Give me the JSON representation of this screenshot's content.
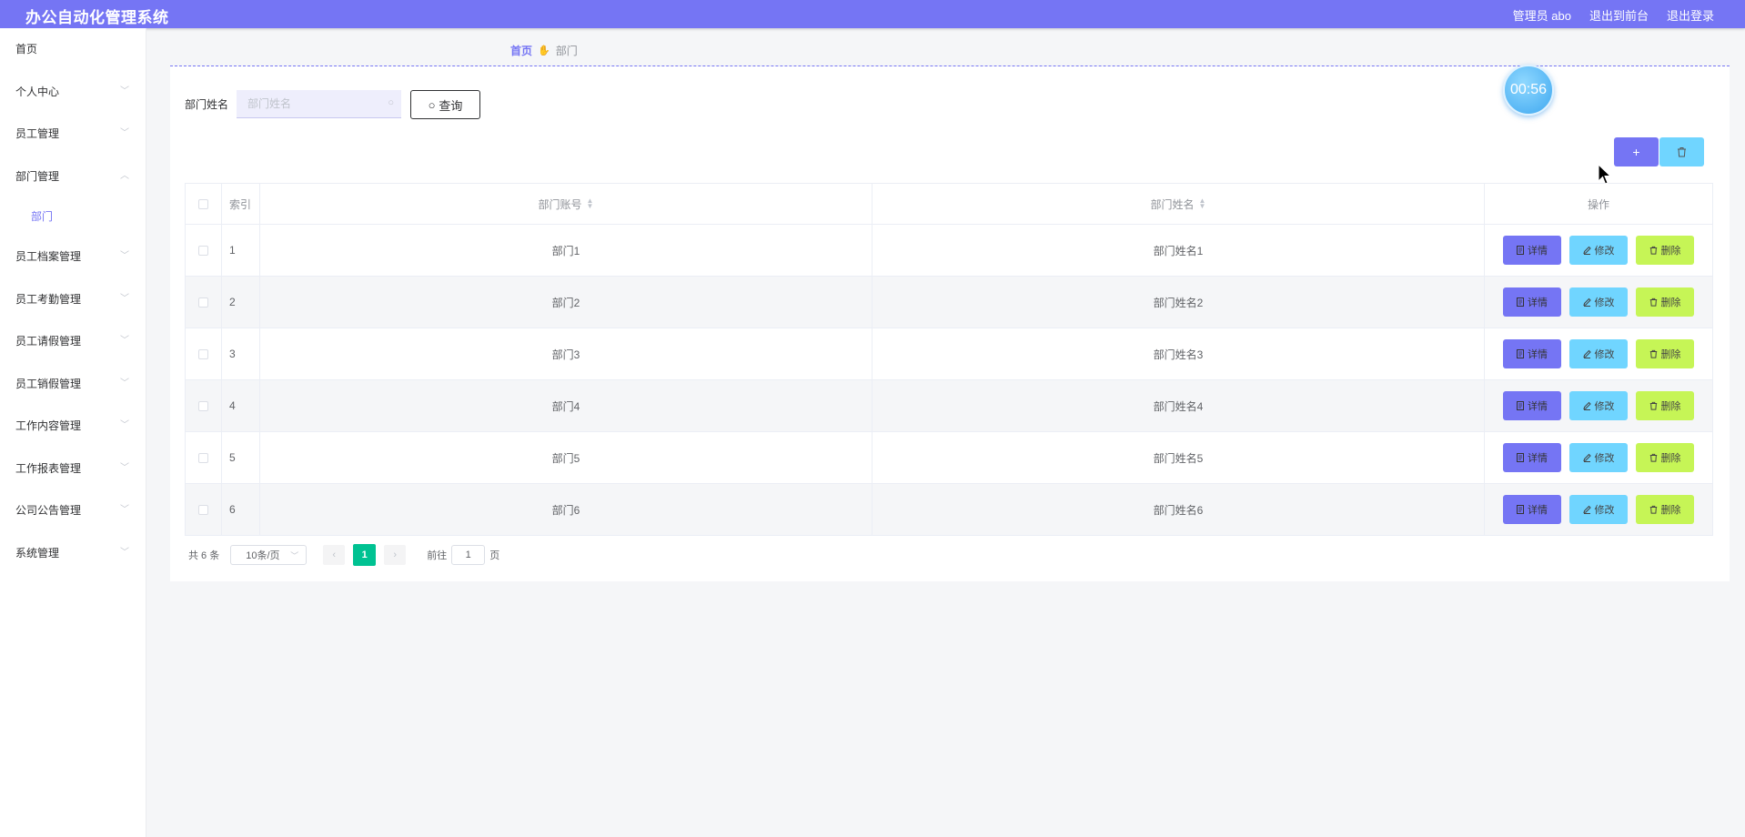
{
  "header": {
    "title": "办公自动化管理系统",
    "user": "管理员 abo",
    "to_front": "退出到前台",
    "logout": "退出登录"
  },
  "sidebar": {
    "items": [
      {
        "label": "首页"
      },
      {
        "label": "个人中心"
      },
      {
        "label": "员工管理"
      },
      {
        "label": "部门管理"
      },
      {
        "label": "员工档案管理"
      },
      {
        "label": "员工考勤管理"
      },
      {
        "label": "员工请假管理"
      },
      {
        "label": "员工销假管理"
      },
      {
        "label": "工作内容管理"
      },
      {
        "label": "工作报表管理"
      },
      {
        "label": "公司公告管理"
      },
      {
        "label": "系统管理"
      }
    ],
    "sub_item": "部门"
  },
  "breadcrumb": {
    "home": "首页",
    "current": "部门"
  },
  "search": {
    "label": "部门姓名",
    "placeholder": "部门姓名",
    "query_label": "查询"
  },
  "actions": {
    "add_label": "+"
  },
  "table": {
    "columns": {
      "index": "索引",
      "account": "部门账号",
      "name": "部门姓名",
      "ops": "操作"
    },
    "op_labels": {
      "detail": "详情",
      "edit": "修改",
      "delete": "删除"
    },
    "rows": [
      {
        "index": "1",
        "account": "部门1",
        "name": "部门姓名1"
      },
      {
        "index": "2",
        "account": "部门2",
        "name": "部门姓名2"
      },
      {
        "index": "3",
        "account": "部门3",
        "name": "部门姓名3"
      },
      {
        "index": "4",
        "account": "部门4",
        "name": "部门姓名4"
      },
      {
        "index": "5",
        "account": "部门5",
        "name": "部门姓名5"
      },
      {
        "index": "6",
        "account": "部门6",
        "name": "部门姓名6"
      }
    ]
  },
  "pagination": {
    "total": "共 6 条",
    "page_size": "10条/页",
    "current_page": "1",
    "goto_prefix": "前往",
    "goto_value": "1",
    "goto_suffix": "页"
  },
  "timer": "00:56",
  "colors": {
    "primary": "#7575f4",
    "info": "#70d5ff",
    "warn": "#c6f556",
    "page_active": "#00c292"
  }
}
